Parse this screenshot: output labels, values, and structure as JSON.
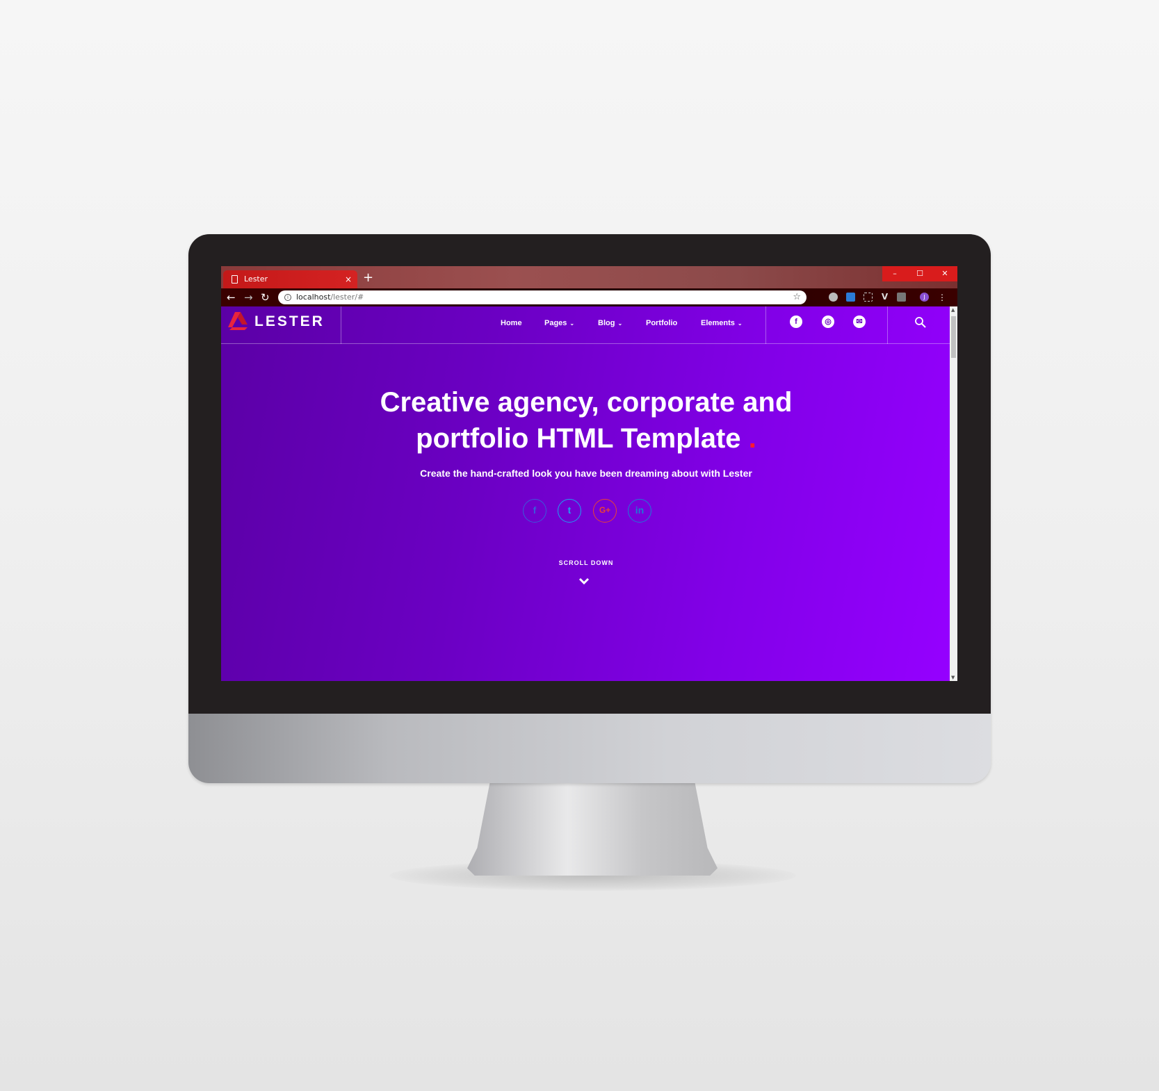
{
  "browser": {
    "tab_title": "Lester",
    "new_tab_symbol": "+",
    "tab_close_symbol": "×",
    "url_host": "localhost",
    "url_path": "/lester/#",
    "window_controls": [
      "–",
      "☐",
      "✕"
    ],
    "profile_initial": "J"
  },
  "site": {
    "logo_text": "LESTER",
    "nav": [
      {
        "label": "Home",
        "has_dropdown": false
      },
      {
        "label": "Pages",
        "has_dropdown": true
      },
      {
        "label": "Blog",
        "has_dropdown": true
      },
      {
        "label": "Portfolio",
        "has_dropdown": false
      },
      {
        "label": "Elements",
        "has_dropdown": true
      }
    ],
    "header_social": [
      {
        "icon": "facebook-icon",
        "glyph": "f"
      },
      {
        "icon": "instagram-icon",
        "glyph": "◎"
      },
      {
        "icon": "email-icon",
        "glyph": "✉"
      }
    ]
  },
  "hero": {
    "title_line1": "Creative agency, corporate and",
    "title_line2": "portfolio HTML Template",
    "title_dot": ".",
    "subtitle": "Create the hand-crafted look you have been dreaming about with Lester",
    "social": [
      {
        "icon": "facebook-icon",
        "glyph": "f",
        "color": "#3b5bdb"
      },
      {
        "icon": "twitter-icon",
        "glyph": "t",
        "color": "#1da1f2"
      },
      {
        "icon": "google-plus-icon",
        "glyph": "G+",
        "color": "#ea4335"
      },
      {
        "icon": "linkedin-icon",
        "glyph": "in",
        "color": "#1e7ad6"
      }
    ],
    "scroll_label": "SCROLL DOWN"
  },
  "colors": {
    "accent_red": "#ff1a2e",
    "hero_gradient_start": "#5b00a6",
    "hero_gradient_end": "#9500ff"
  }
}
